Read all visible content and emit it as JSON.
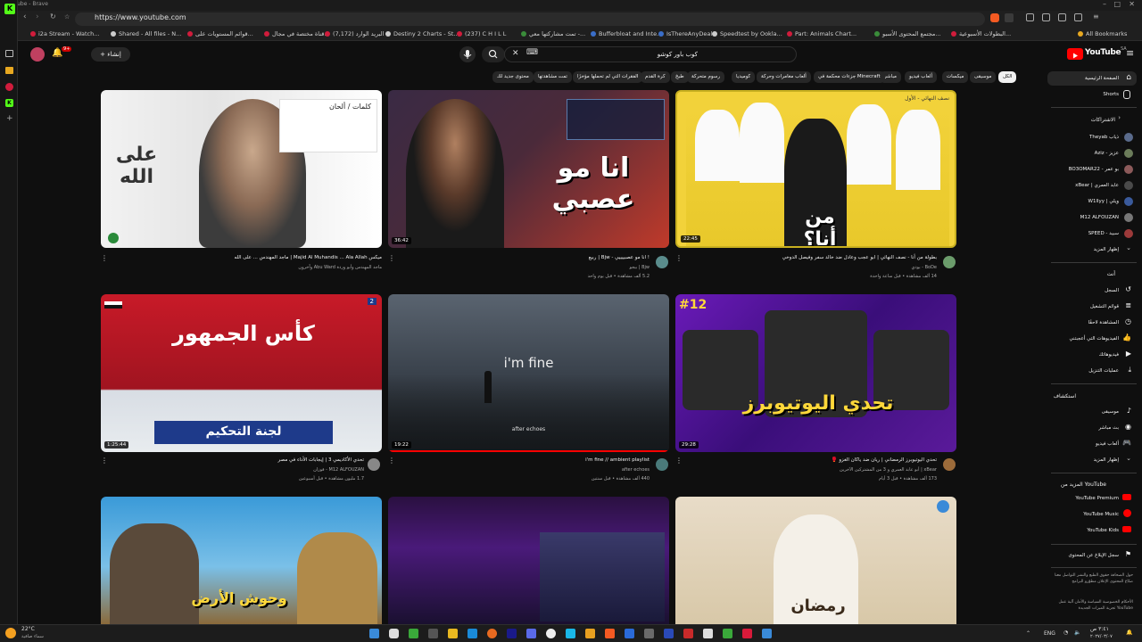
{
  "browser": {
    "window_title": "YouTube - Brave",
    "url": "https://www.youtube.com",
    "bookmarks": [
      "i2a Stream - Watch...",
      "Shared - All files - N...",
      "قوائم المستويات على...",
      "قناة مختصة في مجال...",
      "(7,172) البريد الوارد",
      "Destiny 2 Charts - St...",
      "(237) C H I L L",
      "تمت مشاركتها معي -...",
      "Bufferbloat and Inte...",
      "IsThereAnyDeal",
      "Speedtest by Ookla...",
      "Part: Animals Chart...",
      "مجتمع المحتوى الأسبو...",
      "البطولات الأسبوعية...",
      "All Bookmarks"
    ]
  },
  "topbar": {
    "search_value": "كوب باور كوشو",
    "create_label": "إنشاء",
    "logo_text": "YouTube",
    "logo_suffix": "SA"
  },
  "chips": [
    "الكل",
    "موسيقى",
    "ميكسات",
    "ألعاب فيديو",
    "مباشر",
    "جزءات محكمة في Minecraft",
    "ألعاب مغامرات وحركة",
    "كوميديا",
    "رسوم متحركة",
    "طبخ",
    "كرة القدم",
    "الفقرات التي لم تحملها مؤخرًا",
    "تمت مشاهدتها",
    "محتوى جديد لك"
  ],
  "sidebar": {
    "home": "الصفحة الرئيسية",
    "shorts": "Shorts",
    "subscriptions_header": "الاشتراكات",
    "channels": [
      {
        "name": "Theyab ذياب",
        "color": "#5a6b8c"
      },
      {
        "name": "Aziz - عزيز",
        "color": "#6b7c5a"
      },
      {
        "name": "BO3OMAR22 - بو عمر",
        "color": "#8c5a5a"
      },
      {
        "name": "xBear | عابد العمري",
        "color": "#4a4a4a"
      },
      {
        "name": "W1llyy | ويلي",
        "color": "#3a5a9c"
      },
      {
        "name": "M12 ALFOUZAN",
        "color": "#777777"
      },
      {
        "name": "SPEED - سبيد",
        "color": "#9c3a3a"
      }
    ],
    "show_more": "إظهار المزيد",
    "you_header": "أنت",
    "you_items": [
      "السجل",
      "قوائم التشغيل",
      "المشاهدة لاحقًا",
      "الفيديوهات التي أعجبتني",
      "فيديوهاتك",
      "عمليات التنزيل"
    ],
    "explore_header": "استكشاف",
    "explore_items": [
      "موسيقى",
      "بث مباشر",
      "ألعاب فيديو",
      "إظهار المزيد"
    ],
    "more_header": "المزيد من YouTube",
    "more_items": [
      "YouTube Premium",
      "YouTube Music",
      "YouTube Kids"
    ],
    "report": "سجل الإبلاغ عن المحتوى",
    "footer1": "حول  الصحافة  حقوق الطبع والنشر  التواصل معنا  صنّاع المحتوى  الإعلان  مطوّرو البرامج",
    "footer2": "الأحكام  الخصوصية  السياسة والأمان  آلية عمل YouTube  تجربة الميزات الجديدة"
  },
  "videos": [
    {
      "title": "ميكس Majid Al Muhandis ... Ala Allah | ماجد المهندس ... على الله",
      "meta1": "ماجد المهندس وأبو وردة Abu Ward وآخرون",
      "meta2": "",
      "duration": "",
      "thumb_caption": "على الله",
      "thumb_sub": "كلمات / ألحان",
      "av": "#ccc"
    },
    {
      "title": "! انا مو عصبييييي - Bjw | ربيع",
      "meta1": "Bjw | بيجو",
      "meta2": "5.2 ألف مشاهدة • قبل يوم واحد",
      "duration": "36:42",
      "thumb_caption": "انا مو عصبي",
      "thumb_sub": "",
      "av": "#5a8c8c"
    },
    {
      "title": "بطولة من أنا - نصف النهائي | ابو عجب وعادل ضد خالد سفر وفيصل الدوخي",
      "meta1": "BoDe - بودي",
      "meta2": "14 ألف مشاهدة • قبل ساعة واحدة",
      "duration": "22:45",
      "thumb_caption": "من أنا؟",
      "thumb_sub": "نصف النهائي - الأول",
      "av": "#6b9c6b"
    },
    {
      "title": "تحدي الأكاديمي 3 | إيجابات الأداء في مصر",
      "meta1": "M12 ALFOUZAN - فوزان",
      "meta2": "1.7 مليون مشاهدة • قبل أسبوعين",
      "duration": "1:25:44",
      "thumb_caption": "كأس الجمهور",
      "thumb_sub": "لجنة التحكيم",
      "av": "#888"
    },
    {
      "title": "i'm fine // ambient playlist",
      "meta1": "after echoes",
      "meta2": "440 ألف مشاهدة • قبل سنتين",
      "duration": "19:22",
      "thumb_caption": "i'm fine",
      "thumb_sub": "after echoes",
      "av": "#4a7a7a"
    },
    {
      "title": "تحدي اليوتيوبرز الرمضاني | ريان ضد ياكان الغزو 🥊",
      "meta1": "xBear | أبو عابد العمري و 3 من المشتركين الآخرين",
      "meta2": "173 ألف مشاهدة • قبل 3 أيام",
      "duration": "29:28",
      "thumb_caption": "تحدي اليوتيوبرز",
      "thumb_sub": "#12",
      "av": "#9c6b3a"
    },
    {
      "title": "",
      "meta1": "",
      "meta2": "",
      "duration": "",
      "thumb_caption": "وحوش الأرض",
      "thumb_sub": "",
      "av": ""
    },
    {
      "title": "",
      "meta1": "",
      "meta2": "",
      "duration": "",
      "thumb_caption": "",
      "thumb_sub": "",
      "av": ""
    },
    {
      "title": "",
      "meta1": "",
      "meta2": "",
      "duration": "",
      "thumb_caption": "رمضان",
      "thumb_sub": "",
      "av": ""
    }
  ],
  "taskbar": {
    "weather_temp": "22°C",
    "weather_desc": "سماء صافية",
    "lang": "ENG",
    "time": "٣:٤١ ص",
    "date": "٢٠٢٧/٠٣/٠٧"
  },
  "colors": {
    "accent": "#ff0000",
    "bg": "#0f0f0f",
    "chip": "#272727"
  }
}
